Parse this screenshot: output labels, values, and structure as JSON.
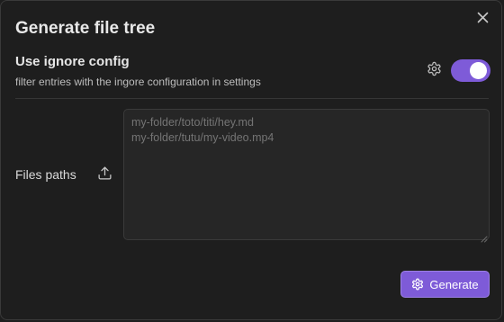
{
  "modal": {
    "title": "Generate file tree",
    "close_icon": "close-icon"
  },
  "ignore_setting": {
    "name": "Use ignore config",
    "description": "filter entries with the ingore configuration in settings",
    "enabled": true,
    "gear_icon": "gear-icon"
  },
  "files": {
    "label": "Files paths",
    "upload_icon": "upload-icon",
    "value": "",
    "placeholder": "my-folder/toto/titi/hey.md\nmy-folder/tutu/my-video.mp4"
  },
  "actions": {
    "generate_label": "Generate",
    "generate_icon": "gear-icon"
  },
  "colors": {
    "background": "#1e1e1e",
    "accent": "#7e5bd8",
    "text": "#dadada",
    "muted": "#747474"
  }
}
